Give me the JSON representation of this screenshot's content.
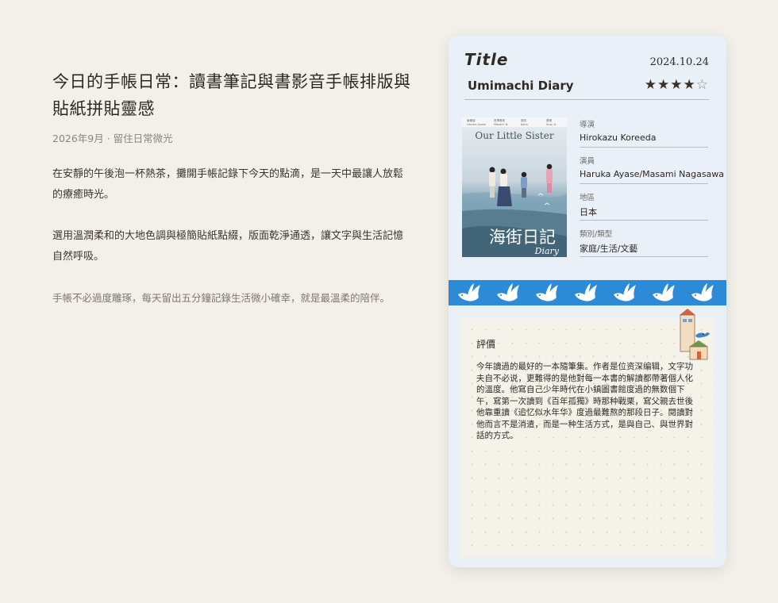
{
  "article": {
    "title": "今日的手帳日常：讀書筆記與書影音手帳排版與貼紙拼貼靈感",
    "meta": "2026年9月 · 留住日常微光",
    "paragraphs": [
      "在安靜的午後泡一杯熱茶，攤開手帳記錄下今天的點滴，是一天中最讓人放鬆的療癒時光。",
      "選用溫潤柔和的大地色調與極簡貼紙點綴，版面乾淨通透，讓文字與生活記憶自然呼吸。",
      "手帳不必過度雕琢，每天留出五分鐘記錄生活微小確幸，就是最溫柔的陪伴。"
    ]
  },
  "card": {
    "title_label": "Title",
    "date": "2024.10.24",
    "movie_title": "Umimachi Diary",
    "rating": 4,
    "rating_max": 5,
    "poster": {
      "english_title": "Our Little Sister",
      "chinese_title": "海街日記",
      "diary_text": "Diary"
    },
    "info": [
      {
        "label": "導演",
        "value": "Hirokazu Koreeda"
      },
      {
        "label": "演員",
        "value": "Haruka Ayase/Masami Nagasawa"
      },
      {
        "label": "地區",
        "value": "日本"
      },
      {
        "label": "類別/類型",
        "value": "家庭/生活/文藝"
      }
    ],
    "review": {
      "heading": "評價",
      "text": "今年讀過的最好的一本隨筆集。作者是位资深编辑，文字功夫自不必说，更難得的是他對每一本書的解讀都帶著個人化的溫度。他寫自己少年時代在小鎮圖書館度過的無数個下午，寫第一次讀到《百年孤獨》時那种戰栗，寫父親去世後他靠重讀《追忆似水年华》度過最難熬的那段日子。閱讀對他而言不是消遣，而是一种生活方式，是與自己、與世界對話的方式。"
    }
  },
  "colors": {
    "background": "#f3f0ea",
    "card": "#eaf0f8",
    "tape": "#2d8ad6",
    "review_paper": "#f5f2e9"
  }
}
